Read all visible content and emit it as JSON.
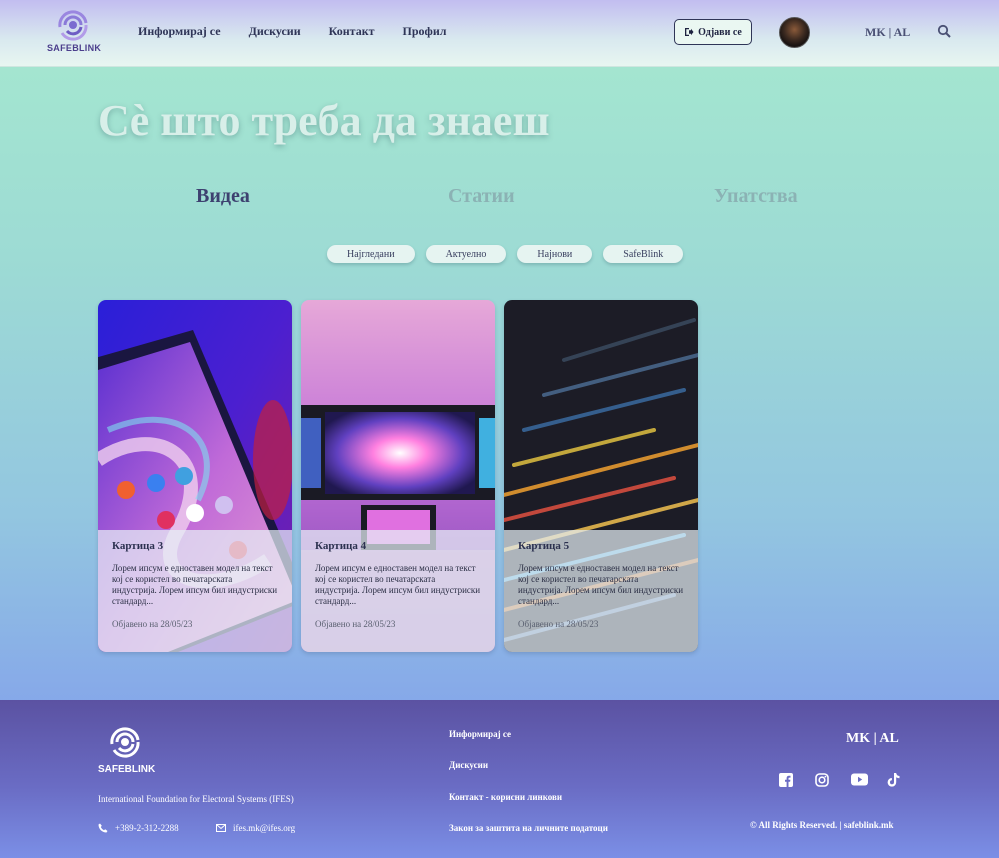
{
  "header": {
    "logo_text": "SAFEBLINK",
    "nav": [
      "Информирај се",
      "Дискусии",
      "Контакт",
      "Профил"
    ],
    "logout_label": "Одјави се",
    "lang": "MK | AL"
  },
  "hero": {
    "title": "Сè што треба да знаеш"
  },
  "tabs": [
    "Видеа",
    "Статии",
    "Упатства"
  ],
  "active_tab": "Видеа",
  "filters": [
    "Најгледани",
    "Актуелно",
    "Најнови",
    "SafeBlink"
  ],
  "cards": [
    {
      "title": "Картица 3",
      "description": "Лорем ипсум е едноставен модел на текст кој се користел во печатарската индустрија. Лорем ипсум бил индустриски стандард...",
      "date": "Објавено на 28/05/23"
    },
    {
      "title": "Картица 4",
      "description": "Лорем ипсум е едноставен модел на текст кој се користел во печатарската индустрија. Лорем ипсум бил индустриски стандард...",
      "date": "Објавено на 28/05/23"
    },
    {
      "title": "Картица 5",
      "description": "Лорем ипсум е едноставен модел на текст кој се користел во печатарската индустрија. Лорем ипсум бил индустриски стандард...",
      "date": "Објавено на 28/05/23"
    }
  ],
  "footer": {
    "logo_text": "SAFEBLINK",
    "org": "International Foundation for Electoral Systems (IFES)",
    "phone": "+389-2-312-2288",
    "email": "ifes.mk@ifes.org",
    "links": [
      "Информирај се",
      "Дискусии",
      "Контакт - корисни линкови",
      "Закон за заштита на личните податоци"
    ],
    "lang": "MK | AL",
    "socials": [
      "facebook-icon",
      "instagram-icon",
      "youtube-icon",
      "tiktok-icon"
    ],
    "copyright": "© All Rights Reserved. | safeblink.mk"
  },
  "colors": {
    "accent": "#5b52a2",
    "text_dark": "#2f3557"
  }
}
